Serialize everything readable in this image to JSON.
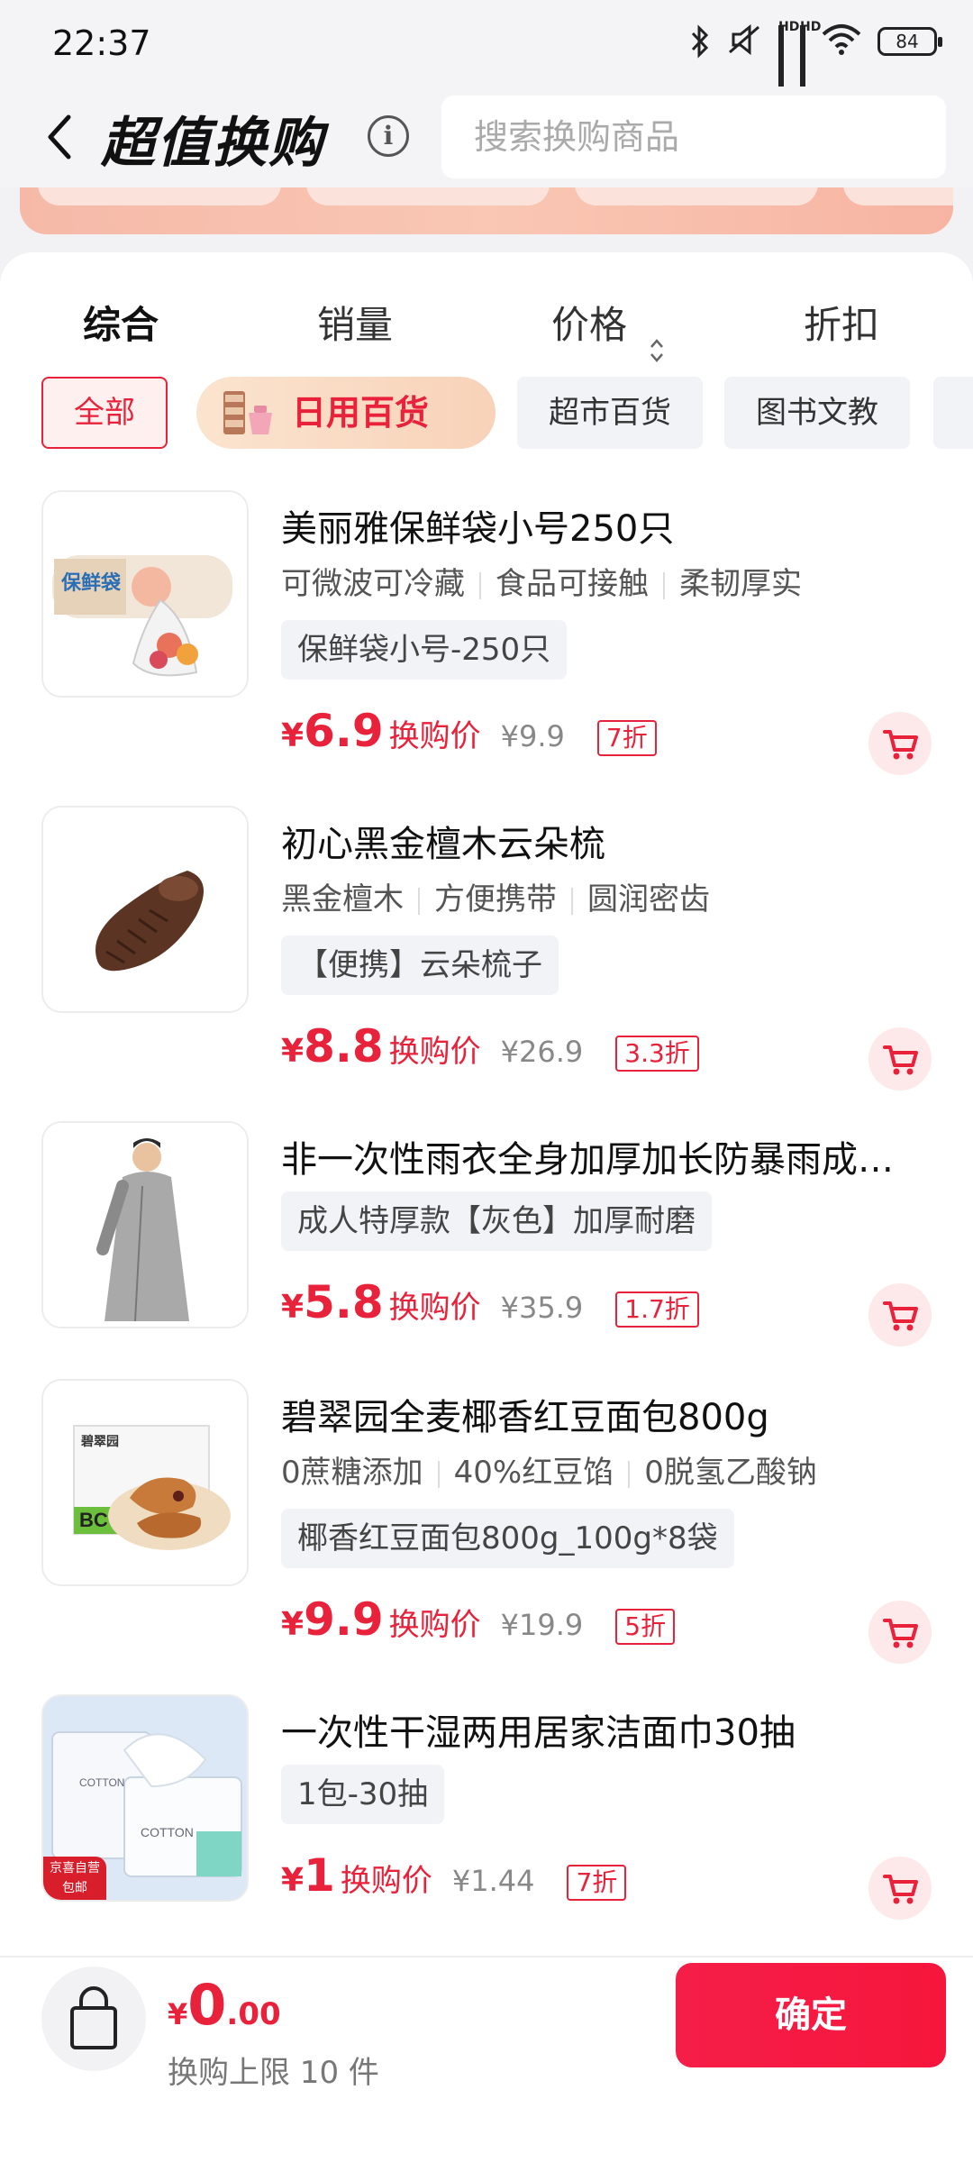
{
  "status": {
    "time": "22:37",
    "battery": "84",
    "signal_label": "HD"
  },
  "header": {
    "title": "超值换购",
    "search_placeholder": "搜索换购商品"
  },
  "sort_tabs": [
    "综合",
    "销量",
    "价格",
    "折扣"
  ],
  "categories": [
    "全部",
    "日用百货",
    "超市百货",
    "图书文教"
  ],
  "products": [
    {
      "name": "美丽雅保鲜袋小号250只",
      "tags": [
        "可微波可冷藏",
        "食品可接触",
        "柔韧厚实"
      ],
      "spec": "保鲜袋小号-250只",
      "currency": "¥",
      "price": "6.9",
      "price_label": "换购价",
      "original": "¥9.9",
      "discount": "7折",
      "thumb_text": "保鲜袋"
    },
    {
      "name": "初心黑金檀木云朵梳",
      "tags": [
        "黑金檀木",
        "方便携带",
        "圆润密齿"
      ],
      "spec": "【便携】云朵梳子",
      "currency": "¥",
      "price": "8.8",
      "price_label": "换购价",
      "original": "¥26.9",
      "discount": "3.3折"
    },
    {
      "name": "非一次性雨衣全身加厚加长防暴雨成…",
      "tags": [],
      "spec": "成人特厚款【灰色】加厚耐磨",
      "currency": "¥",
      "price": "5.8",
      "price_label": "换购价",
      "original": "¥35.9",
      "discount": "1.7折"
    },
    {
      "name": "碧翠园全麦椰香红豆面包800g",
      "tags": [
        "0蔗糖添加",
        "40%红豆馅",
        "0脱氢乙酸钠"
      ],
      "spec": "椰香红豆面包800g_100g*8袋",
      "currency": "¥",
      "price": "9.9",
      "price_label": "换购价",
      "original": "¥19.9",
      "discount": "5折",
      "thumb_text": "碧翠园"
    },
    {
      "name": "一次性干湿两用居家洁面巾30抽",
      "tags": [],
      "spec": "1包-30抽",
      "currency": "¥",
      "price": "1",
      "price_label": "换购价",
      "original": "¥1.44",
      "discount": "7折",
      "thumb_text": "COTTON",
      "thumb_badge": "京喜自营 包邮"
    }
  ],
  "bottom": {
    "currency": "¥",
    "total_int": "0",
    "total_dec": ".00",
    "limit_text": "换购上限 10 件",
    "confirm_label": "确定"
  },
  "colors": {
    "accent": "#e8223a",
    "price": "#e8223a",
    "confirm": "#f51e48"
  }
}
